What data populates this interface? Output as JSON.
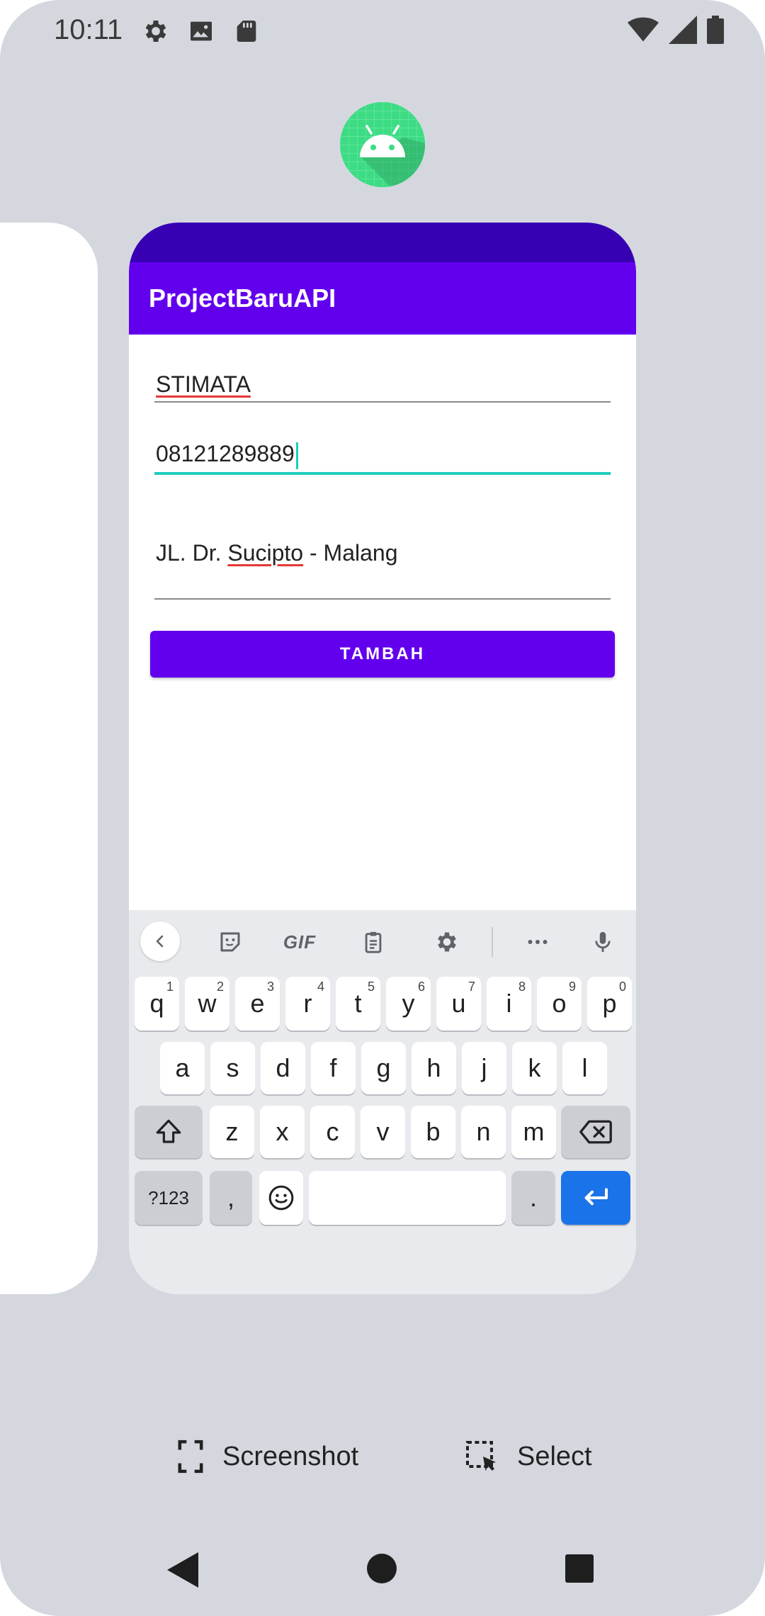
{
  "status_bar": {
    "time": "10:11",
    "left_icons": [
      "settings-icon",
      "image-icon",
      "sd-card-icon"
    ],
    "right_icons": [
      "wifi-icon",
      "signal-icon",
      "battery-icon"
    ]
  },
  "app": {
    "title": "ProjectBaruAPI",
    "colors": {
      "primary": "#6200ee",
      "primary_dark": "#3700b3",
      "accent": "#1fcdbd"
    },
    "form": {
      "name_value": "STIMATA",
      "phone_value": "08121289889",
      "address_prefix": "JL. Dr. ",
      "address_misspelled": "Sucipto",
      "address_suffix": " - Malang",
      "submit_label": "TAMBAH"
    }
  },
  "keyboard": {
    "toolbar": {
      "gif_label": "GIF"
    },
    "row1": [
      {
        "k": "q",
        "h": "1"
      },
      {
        "k": "w",
        "h": "2"
      },
      {
        "k": "e",
        "h": "3"
      },
      {
        "k": "r",
        "h": "4"
      },
      {
        "k": "t",
        "h": "5"
      },
      {
        "k": "y",
        "h": "6"
      },
      {
        "k": "u",
        "h": "7"
      },
      {
        "k": "i",
        "h": "8"
      },
      {
        "k": "o",
        "h": "9"
      },
      {
        "k": "p",
        "h": "0"
      }
    ],
    "row2": [
      "a",
      "s",
      "d",
      "f",
      "g",
      "h",
      "j",
      "k",
      "l"
    ],
    "row3": [
      "z",
      "x",
      "c",
      "v",
      "b",
      "n",
      "m"
    ],
    "symbols_label": "?123",
    "comma_label": ",",
    "period_label": "."
  },
  "overview_actions": {
    "screenshot_label": "Screenshot",
    "select_label": "Select"
  }
}
